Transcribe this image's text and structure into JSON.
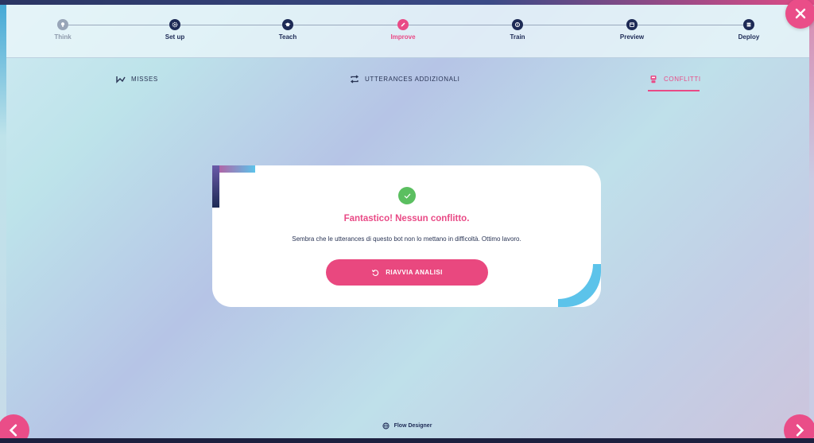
{
  "stepper": {
    "steps": [
      {
        "label": "Think",
        "icon": "bulb-icon",
        "state": "done"
      },
      {
        "label": "Set up",
        "icon": "gear-icon",
        "state": "pending"
      },
      {
        "label": "Teach",
        "icon": "graduation-cap-icon",
        "state": "pending"
      },
      {
        "label": "Improve",
        "icon": "pencil-icon",
        "state": "active"
      },
      {
        "label": "Train",
        "icon": "brain-icon",
        "state": "pending"
      },
      {
        "label": "Preview",
        "icon": "calendar-icon",
        "state": "pending"
      },
      {
        "label": "Deploy",
        "icon": "server-icon",
        "state": "pending"
      }
    ]
  },
  "tabs": [
    {
      "label": "MISSES",
      "icon": "checkmark-arrow-icon"
    },
    {
      "label": "UTTERANCES ADDIZIONALI",
      "icon": "repeat-icon"
    },
    {
      "label": "CONFLITTI",
      "icon": "robot-icon",
      "active": true
    }
  ],
  "card": {
    "title": "Fantastico! Nessun conflitto.",
    "message": "Sembra che le utterances di questo bot non lo mettano in difficoltà. Ottimo lavoro.",
    "button_label": "RIAVVIA ANALISI"
  },
  "footer": {
    "label": "Flow Designer",
    "icon": "globe-icon"
  },
  "colors": {
    "accent": "#e94a86",
    "navy": "#1d2a55",
    "success": "#5bbf60",
    "cyan": "#5cc3ea"
  }
}
